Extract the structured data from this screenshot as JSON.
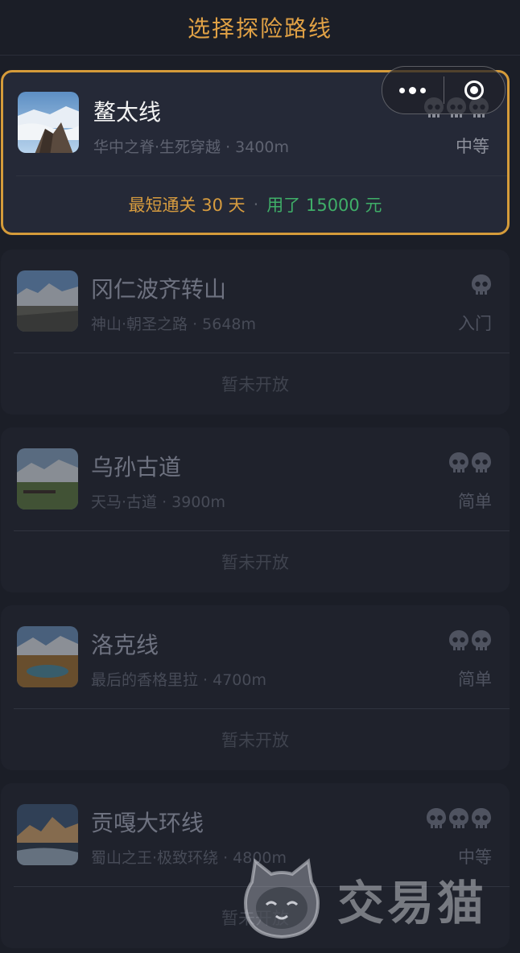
{
  "header": {
    "title": "选择探险路线"
  },
  "capsule": {
    "more_icon": "more-dots-icon",
    "close_icon": "close-circle-icon"
  },
  "routes": [
    {
      "name": "鳌太线",
      "subtitle": "华中之脊·生死穿越 · 3400m",
      "difficulty": "中等",
      "skulls": 3,
      "best_label": "最短通关 30 天",
      "cost_label": "用了 15000 元",
      "separator": "·",
      "status": "active"
    },
    {
      "name": "冈仁波齐转山",
      "subtitle": "神山·朝圣之路 · 5648m",
      "difficulty": "入门",
      "skulls": 1,
      "locked_label": "暂未开放",
      "status": "locked"
    },
    {
      "name": "乌孙古道",
      "subtitle": "天马·古道 · 3900m",
      "difficulty": "简单",
      "skulls": 2,
      "locked_label": "暂未开放",
      "status": "locked"
    },
    {
      "name": "洛克线",
      "subtitle": "最后的香格里拉 · 4700m",
      "difficulty": "简单",
      "skulls": 2,
      "locked_label": "暂未开放",
      "status": "locked"
    },
    {
      "name": "贡嘎大环线",
      "subtitle": "蜀山之王·极致环绕 · 4800m",
      "difficulty": "中等",
      "skulls": 3,
      "locked_label": "暂未开放",
      "status": "locked"
    }
  ],
  "watermark": {
    "text": "交易猫"
  },
  "colors": {
    "accent": "#e0a145",
    "green": "#3fae68",
    "bg": "#1b1e27",
    "card": "#232734"
  }
}
